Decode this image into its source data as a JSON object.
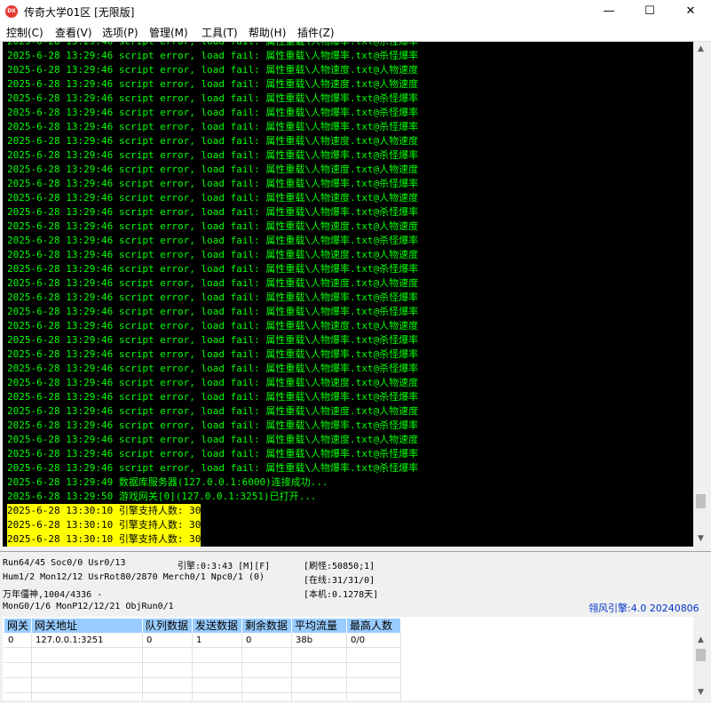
{
  "window": {
    "title": "传奇大学01区 [无限版]",
    "icon_label": "DX",
    "buttons": {
      "minimize": "—",
      "maximize": "☐",
      "close": "✕"
    }
  },
  "menu": [
    "控制(C)",
    "查看(V)",
    "选项(P)",
    "管理(M)",
    "工具(T)",
    "帮助(H)",
    "插件(Z)"
  ],
  "log": {
    "partial_line": "2025-6-28 13:29:46 script error, load fail: 属性重载\\人物爆率.txt@杀怪爆率",
    "lines": [
      {
        "text": "2025-6-28 13:29:46 script error, load fail: 属性重载\\人物爆率.txt@杀怪爆率",
        "style": "green"
      },
      {
        "text": "2025-6-28 13:29:46 script error, load fail: 属性重载\\人物速度.txt@人物速度",
        "style": "green"
      },
      {
        "text": "2025-6-28 13:29:46 script error, load fail: 属性重载\\人物速度.txt@人物速度",
        "style": "green"
      },
      {
        "text": "2025-6-28 13:29:46 script error, load fail: 属性重载\\人物爆率.txt@杀怪爆率",
        "style": "green"
      },
      {
        "text": "2025-6-28 13:29:46 script error, load fail: 属性重载\\人物爆率.txt@杀怪爆率",
        "style": "green"
      },
      {
        "text": "2025-6-28 13:29:46 script error, load fail: 属性重载\\人物爆率.txt@杀怪爆率",
        "style": "green"
      },
      {
        "text": "2025-6-28 13:29:46 script error, load fail: 属性重载\\人物速度.txt@人物速度",
        "style": "green"
      },
      {
        "text": "2025-6-28 13:29:46 script error, load fail: 属性重载\\人物爆率.txt@杀怪爆率",
        "style": "green"
      },
      {
        "text": "2025-6-28 13:29:46 script error, load fail: 属性重载\\人物速度.txt@人物速度",
        "style": "green"
      },
      {
        "text": "2025-6-28 13:29:46 script error, load fail: 属性重载\\人物爆率.txt@杀怪爆率",
        "style": "green"
      },
      {
        "text": "2025-6-28 13:29:46 script error, load fail: 属性重载\\人物速度.txt@人物速度",
        "style": "green"
      },
      {
        "text": "2025-6-28 13:29:46 script error, load fail: 属性重载\\人物爆率.txt@杀怪爆率",
        "style": "green"
      },
      {
        "text": "2025-6-28 13:29:46 script error, load fail: 属性重载\\人物速度.txt@人物速度",
        "style": "green"
      },
      {
        "text": "2025-6-28 13:29:46 script error, load fail: 属性重载\\人物爆率.txt@杀怪爆率",
        "style": "green"
      },
      {
        "text": "2025-6-28 13:29:46 script error, load fail: 属性重载\\人物速度.txt@人物速度",
        "style": "green"
      },
      {
        "text": "2025-6-28 13:29:46 script error, load fail: 属性重载\\人物爆率.txt@杀怪爆率",
        "style": "green"
      },
      {
        "text": "2025-6-28 13:29:46 script error, load fail: 属性重载\\人物速度.txt@人物速度",
        "style": "green"
      },
      {
        "text": "2025-6-28 13:29:46 script error, load fail: 属性重载\\人物爆率.txt@杀怪爆率",
        "style": "green"
      },
      {
        "text": "2025-6-28 13:29:46 script error, load fail: 属性重载\\人物爆率.txt@杀怪爆率",
        "style": "green"
      },
      {
        "text": "2025-6-28 13:29:46 script error, load fail: 属性重载\\人物速度.txt@人物速度",
        "style": "green"
      },
      {
        "text": "2025-6-28 13:29:46 script error, load fail: 属性重载\\人物爆率.txt@杀怪爆率",
        "style": "green"
      },
      {
        "text": "2025-6-28 13:29:46 script error, load fail: 属性重载\\人物爆率.txt@杀怪爆率",
        "style": "green"
      },
      {
        "text": "2025-6-28 13:29:46 script error, load fail: 属性重载\\人物爆率.txt@杀怪爆率",
        "style": "green"
      },
      {
        "text": "2025-6-28 13:29:46 script error, load fail: 属性重载\\人物速度.txt@人物速度",
        "style": "green"
      },
      {
        "text": "2025-6-28 13:29:46 script error, load fail: 属性重载\\人物爆率.txt@杀怪爆率",
        "style": "green"
      },
      {
        "text": "2025-6-28 13:29:46 script error, load fail: 属性重载\\人物速度.txt@人物速度",
        "style": "green"
      },
      {
        "text": "2025-6-28 13:29:46 script error, load fail: 属性重载\\人物爆率.txt@杀怪爆率",
        "style": "green"
      },
      {
        "text": "2025-6-28 13:29:46 script error, load fail: 属性重载\\人物速度.txt@人物速度",
        "style": "green"
      },
      {
        "text": "2025-6-28 13:29:46 script error, load fail: 属性重载\\人物爆率.txt@杀怪爆率",
        "style": "green"
      },
      {
        "text": "2025-6-28 13:29:46 script error, load fail: 属性重载\\人物爆率.txt@杀怪爆率",
        "style": "green"
      },
      {
        "text": "2025-6-28 13:29:49 数据库服务器(127.0.0.1:6000)连接成功...",
        "style": "green"
      },
      {
        "text": "2025-6-28 13:29:50 游戏网关[0](127.0.0.1:3251)已打开...",
        "style": "green"
      },
      {
        "text": "2025-6-28 13:30:10 引擎支持人数: 30",
        "style": "highlight"
      },
      {
        "text": "2025-6-28 13:30:10 引擎支持人数: 30",
        "style": "highlight"
      },
      {
        "text": "2025-6-28 13:30:10 引擎支持人数: 30",
        "style": "highlight"
      },
      {
        "text": "2025-6-28 13:30:10 引擎支持人数: 30",
        "style": "highlight"
      }
    ],
    "scrollbar": {
      "up": "▲",
      "down": "▼",
      "position": 0.95
    }
  },
  "status": {
    "row1_left": "Run64/45 Soc0/0 Usr0/13",
    "row1_mid": "引擎:0:3:43 [M][F]",
    "row1_right": "[刷怪:50850;1]",
    "row2_left": "Hum1/2 Mon12/12 UsrRot80/2870 Merch0/1 Npc0/1 (0)",
    "row2_right": "[在线:31/31/0]",
    "row3_left": "万年僵神,1004/4336 -",
    "row3_right": "[本机:0.1278天]",
    "row4_left": "MonG0/1/6 MonP12/12/21 ObjRun0/1",
    "engine_version": "翎风引擎:4.0 20240806"
  },
  "gateway_table": {
    "headers": [
      "网关",
      "网关地址",
      "队列数据",
      "发送数据",
      "剩余数据",
      "平均流量",
      "最高人数"
    ],
    "rows": [
      [
        "0",
        "127.0.0.1:3251",
        "0",
        "1",
        "0",
        "38b",
        "0/0"
      ]
    ],
    "scrollbar": {
      "up": "▲",
      "down": "▼"
    }
  },
  "colors": {
    "log_bg": "#000000",
    "log_green": "#00ff00",
    "highlight_bg": "#ffff00",
    "header_bg": "#99ccff",
    "engine_text": "#0033cc"
  }
}
